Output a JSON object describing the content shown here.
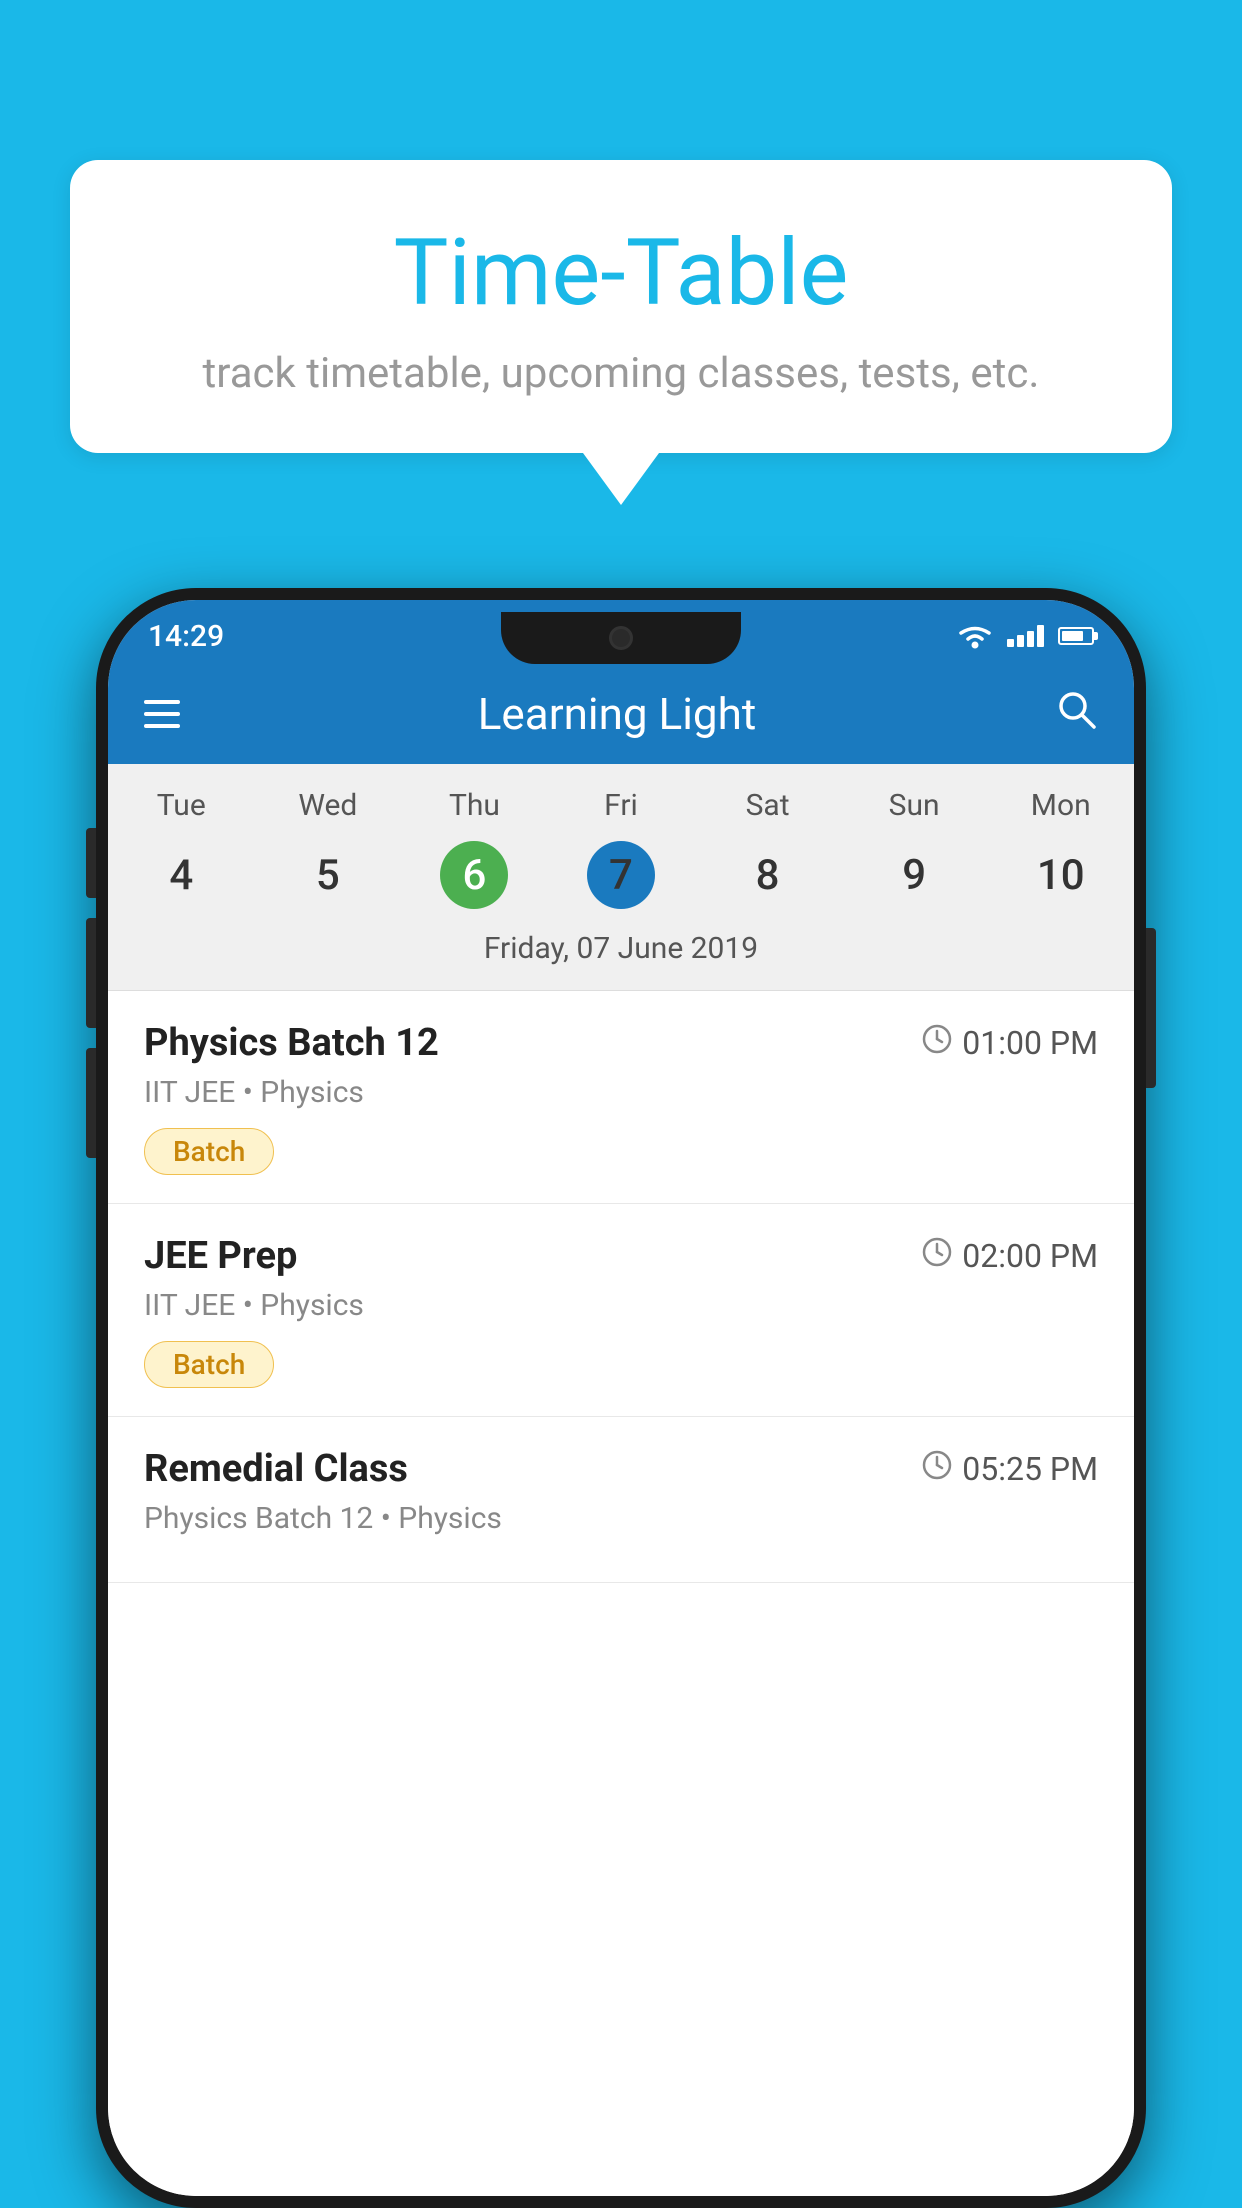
{
  "background": {
    "color": "#1ab8e8"
  },
  "speech_bubble": {
    "title": "Time-Table",
    "subtitle": "track timetable, upcoming classes, tests, etc."
  },
  "phone": {
    "status_bar": {
      "time": "14:29"
    },
    "app_bar": {
      "title": "Learning Light"
    },
    "calendar": {
      "day_names": [
        "Tue",
        "Wed",
        "Thu",
        "Fri",
        "Sat",
        "Sun",
        "Mon"
      ],
      "day_numbers": [
        "4",
        "5",
        "6",
        "7",
        "8",
        "9",
        "10"
      ],
      "today_index": 2,
      "selected_index": 3,
      "date_label": "Friday, 07 June 2019"
    },
    "schedule": [
      {
        "title": "Physics Batch 12",
        "time": "01:00 PM",
        "subtitle": "IIT JEE • Physics",
        "tag": "Batch"
      },
      {
        "title": "JEE Prep",
        "time": "02:00 PM",
        "subtitle": "IIT JEE • Physics",
        "tag": "Batch"
      },
      {
        "title": "Remedial Class",
        "time": "05:25 PM",
        "subtitle": "Physics Batch 12 • Physics",
        "tag": null
      }
    ]
  }
}
